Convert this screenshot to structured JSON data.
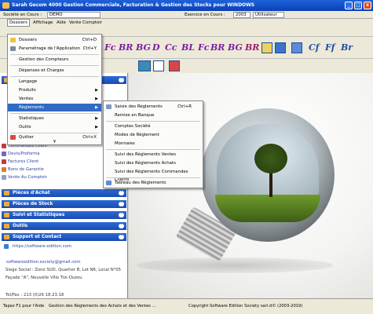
{
  "window": {
    "title": "Sarah Gecom 4000 Gestion Commerciale, Facturation & Gestion des Stocks pour WINDOWS",
    "minimize": "_",
    "maximize": "□",
    "close": "x"
  },
  "infobar": {
    "company_label": "Société en Cours :",
    "company_value": "DEMO",
    "year_label": "Exercice en Cours :",
    "year_value": "2003",
    "user_value": "Utilisateur"
  },
  "menubar": [
    "Dossiers",
    "Affichage",
    "Aide",
    "Vente Comptoir"
  ],
  "toolbar_letters": [
    "Fc",
    "BR",
    "BG",
    "D",
    "Cc",
    "BL",
    "Fc",
    "BR",
    "BG",
    "BR"
  ],
  "toolbar_letters2": [
    "Cf",
    "Ff",
    "Br"
  ],
  "dossiers_menu": {
    "items": [
      {
        "label": "Dossiers",
        "shortcut": "Ctrl+D"
      },
      {
        "label": "Paramétrage de l'Application",
        "shortcut": "Ctrl+Y"
      },
      {
        "label": "Gestion des Compteurs",
        "shortcut": ""
      },
      {
        "label": "Dépenses et Charges",
        "shortcut": ""
      },
      {
        "label": "Langage",
        "shortcut": ""
      },
      {
        "label": "Produits",
        "shortcut": ""
      },
      {
        "label": "Ventes",
        "shortcut": ""
      },
      {
        "label": "Règlements",
        "shortcut": ""
      },
      {
        "label": "Statistiques",
        "shortcut": ""
      },
      {
        "label": "Outils",
        "shortcut": ""
      },
      {
        "label": "Quitter",
        "shortcut": "Ctrl+X"
      }
    ],
    "chevron": "¥"
  },
  "reglements_submenu": {
    "items": [
      {
        "label": "Saisie des Règlements",
        "shortcut": "Ctrl+R"
      },
      {
        "label": "Remise en Banque",
        "shortcut": ""
      },
      {
        "label": "Comptes Société",
        "shortcut": ""
      },
      {
        "label": "Modes de Règlement",
        "shortcut": ""
      },
      {
        "label": "Monnaies",
        "shortcut": ""
      },
      {
        "label": "Suivi des Règlements Ventes",
        "shortcut": ""
      },
      {
        "label": "Suivi des Règlements Achats",
        "shortcut": ""
      },
      {
        "label": "Suivi des Règlements Commandes Clients",
        "shortcut": ""
      },
      {
        "label": "Tableau des Règlements",
        "shortcut": ""
      }
    ]
  },
  "left_panel": {
    "ventes_links": [
      "Commandes Client",
      "Devis/Proforma",
      "Factures Client",
      "Bons de Garantie",
      "Vente Au Comptoir"
    ],
    "sections": [
      "Pièces d'Achat",
      "Pièces de Stock",
      "Suivi et Statistiques",
      "Outils",
      "Support et Contact"
    ],
    "website": "https://software-edition.com",
    "email": "softwareedition.society@gmail.com",
    "address1": "Siege Social : Zone SUD, Quartier B, Lot N6, Local N°05",
    "address2": "Façade \"A\", Nouvelle Ville Tizi-Ouzou",
    "phone": "Tel/Fax : 213 (0)26 18.23.18"
  },
  "statusbar": {
    "hint": "Tapez F1 pour l'Aide",
    "module": "Gestion des Règlements des Achats et des Ventes ...",
    "copyright": "Copyright Software Edition Society sarl.d© (2003-2019)"
  },
  "colors": {
    "title_bar": "#0a3fb8",
    "panel_header": "#1b4bb0",
    "menu_highlight": "#316ac5",
    "toolbar_letter": "#7a1fa2"
  }
}
